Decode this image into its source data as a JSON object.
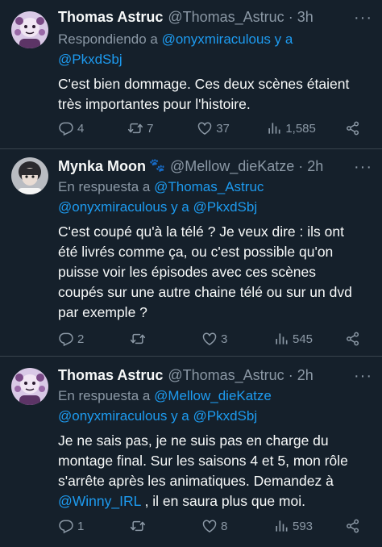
{
  "tweets": [
    {
      "name": "Thomas Astruc",
      "handle": "@Thomas_Astruc",
      "time": "3h",
      "reply_prefix": "Respondiendo a",
      "reply_users": "@onyxmiraculous y a @PkxdSbj",
      "reply_line1_link": "@onyxmiraculous y a",
      "reply_line2_link": "@PkxdSbj",
      "text_lines": [
        "C'est bien dommage. Ces deux scènes étaient",
        "très importantes pour l'histoire."
      ],
      "replies": "4",
      "retweets": "7",
      "likes": "37",
      "views": "1,585"
    },
    {
      "name": "Mynka Moon",
      "emoji": "🐾",
      "handle": "@Mellow_dieKatze",
      "time": "2h",
      "reply_prefix": "En respuesta a",
      "reply_line1_link": "@Thomas_Astruc",
      "reply_line2_link": "@onyxmiraculous y a @PkxdSbj",
      "text_lines": [
        "C'est coupé qu'à la télé ? Je veux dire : ils ont",
        "été livrés comme ça, ou c'est possible qu'on",
        "puisse voir les épisodes avec ces scènes",
        "coupés sur une autre chaine télé ou sur un dvd",
        "par exemple ?"
      ],
      "replies": "2",
      "retweets": "",
      "likes": "3",
      "views": "545"
    },
    {
      "name": "Thomas Astruc",
      "handle": "@Thomas_Astruc",
      "time": "2h",
      "reply_prefix": "En respuesta a",
      "reply_line1_link": "@Mellow_dieKatze",
      "reply_line2_link": "@onyxmiraculous y a @PkxdSbj",
      "text_lines": [
        "Je ne sais pas,  je ne suis pas en charge du",
        "montage final. Sur les saisons 4 et 5, mon rôle",
        "s'arrête après les animatiques. Demandez à"
      ],
      "mention": "@Winny_IRL",
      "text_last": " , il en saura plus que moi.",
      "replies": "1",
      "retweets": "",
      "likes": "8",
      "views": "593"
    }
  ],
  "dot": "·",
  "more": "···",
  "icons": {
    "reply": "reply-icon",
    "retweet": "retweet-icon",
    "like": "like-icon",
    "views": "views-icon",
    "share": "share-icon"
  },
  "colors": {
    "background": "#15202b",
    "text": "#f7f9f9",
    "muted": "#8b98a5",
    "link": "#1d9bf0",
    "separator": "#38444d"
  }
}
